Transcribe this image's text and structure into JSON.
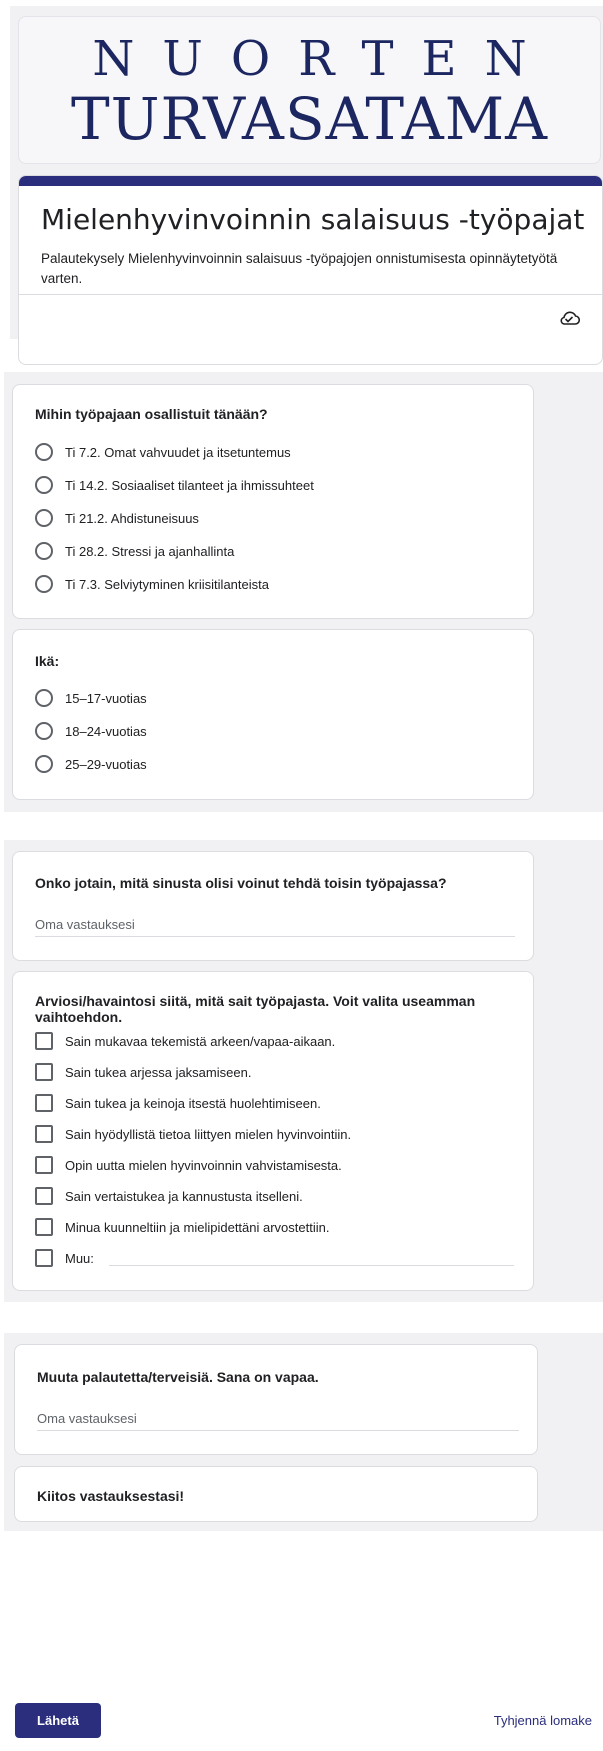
{
  "header": {
    "logo_line1": "NUORTEN",
    "logo_line2": "TURVASATAMA",
    "title": "Mielenhyvinvoinnin salaisuus -työpajat",
    "description": "Palautekysely Mielenhyvinvoinnin salaisuus -työpajojen onnistumisesta opinnäytetyötä varten.",
    "icon": "cloud-check-icon"
  },
  "q_workshop": {
    "title": "Mihin työpajaan osallistuit tänään?",
    "options": [
      "Ti 7.2. Omat vahvuudet ja itsetuntemus",
      "Ti 14.2. Sosiaaliset tilanteet ja ihmissuhteet",
      "Ti 21.2. Ahdistuneisuus",
      "Ti 28.2. Stressi ja ajanhallinta",
      "Ti 7.3. Selviytyminen kriisitilanteista"
    ]
  },
  "q_age": {
    "title": "Ikä:",
    "options": [
      "15–17-vuotias",
      "18–24-vuotias",
      "25–29-vuotias"
    ]
  },
  "q_improve": {
    "title": "Onko jotain, mitä sinusta olisi voinut tehdä toisin työpajassa?",
    "placeholder": "Oma vastauksesi"
  },
  "q_gains": {
    "title": "Arviosi/havaintosi siitä, mitä sait työpajasta. Voit valita useamman vaihtoehdon.",
    "options": [
      "Sain mukavaa tekemistä arkeen/vapaa-aikaan.",
      "Sain tukea arjessa jaksamiseen.",
      "Sain tukea ja keinoja itsestä huolehtimiseen.",
      "Sain hyödyllistä tietoa liittyen mielen hyvinvointiin.",
      "Opin uutta mielen hyvinvoinnin vahvistamisesta.",
      "Sain vertaistukea ja kannustusta itselleni.",
      "Minua kuunneltiin ja mielipidettäni arvostettiin."
    ],
    "other_label": "Muu:"
  },
  "q_feedback": {
    "title": "Muuta palautetta/terveisiä. Sana on vapaa.",
    "placeholder": "Oma vastauksesi"
  },
  "thanks": {
    "text": "Kiitos vastauksestasi!"
  },
  "footer": {
    "submit_label": "Lähetä",
    "clear_label": "Tyhjennä lomake"
  },
  "colors": {
    "accent": "#2a2e7d",
    "logo": "#1c2660",
    "section_bg": "#f1f1f3",
    "border": "#dadce0"
  }
}
